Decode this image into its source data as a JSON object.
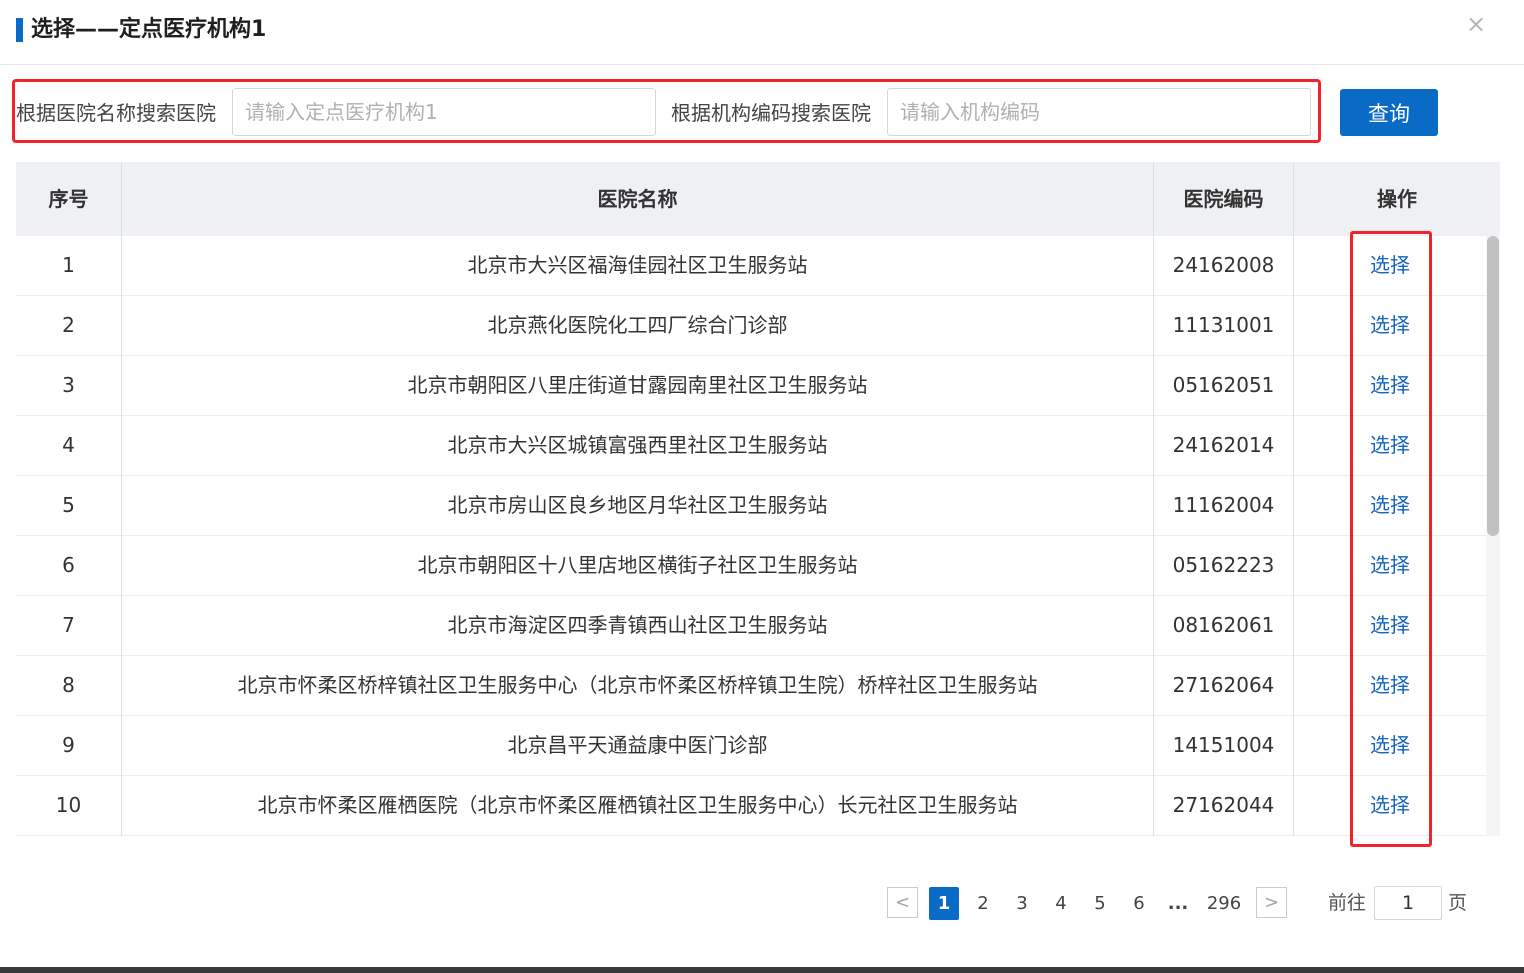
{
  "dialog": {
    "title": "选择——定点医疗机构1",
    "close_glyph": "×"
  },
  "search": {
    "name_label": "根据医院名称搜索医院",
    "name_placeholder": "请输入定点医疗机构1",
    "name_value": "",
    "code_label": "根据机构编码搜索医院",
    "code_placeholder": "请输入机构编码",
    "code_value": "",
    "query_label": "查询"
  },
  "table": {
    "columns": [
      "序号",
      "医院名称",
      "医院编码",
      "操作"
    ],
    "rows": [
      {
        "index": "1",
        "name": "北京市大兴区福海佳园社区卫生服务站",
        "code": "24162008",
        "action": "选择"
      },
      {
        "index": "2",
        "name": "北京燕化医院化工四厂综合门诊部",
        "code": "11131001",
        "action": "选择"
      },
      {
        "index": "3",
        "name": "北京市朝阳区八里庄街道甘露园南里社区卫生服务站",
        "code": "05162051",
        "action": "选择"
      },
      {
        "index": "4",
        "name": "北京市大兴区城镇富强西里社区卫生服务站",
        "code": "24162014",
        "action": "选择"
      },
      {
        "index": "5",
        "name": "北京市房山区良乡地区月华社区卫生服务站",
        "code": "11162004",
        "action": "选择"
      },
      {
        "index": "6",
        "name": "北京市朝阳区十八里店地区横街子社区卫生服务站",
        "code": "05162223",
        "action": "选择"
      },
      {
        "index": "7",
        "name": "北京市海淀区四季青镇西山社区卫生服务站",
        "code": "08162061",
        "action": "选择"
      },
      {
        "index": "8",
        "name": "北京市怀柔区桥梓镇社区卫生服务中心（北京市怀柔区桥梓镇卫生院）桥梓社区卫生服务站",
        "code": "27162064",
        "action": "选择"
      },
      {
        "index": "9",
        "name": "北京昌平天通益康中医门诊部",
        "code": "14151004",
        "action": "选择"
      },
      {
        "index": "10",
        "name": "北京市怀柔区雁栖医院（北京市怀柔区雁栖镇社区卫生服务中心）长元社区卫生服务站",
        "code": "27162044",
        "action": "选择"
      }
    ]
  },
  "pagination": {
    "prev_glyph": "<",
    "next_glyph": ">",
    "pages": [
      "1",
      "2",
      "3",
      "4",
      "5",
      "6"
    ],
    "ellipsis": "...",
    "last_page": "296",
    "current_page": "1",
    "goto_prefix": "前往",
    "goto_value": "1",
    "goto_suffix": "页"
  }
}
